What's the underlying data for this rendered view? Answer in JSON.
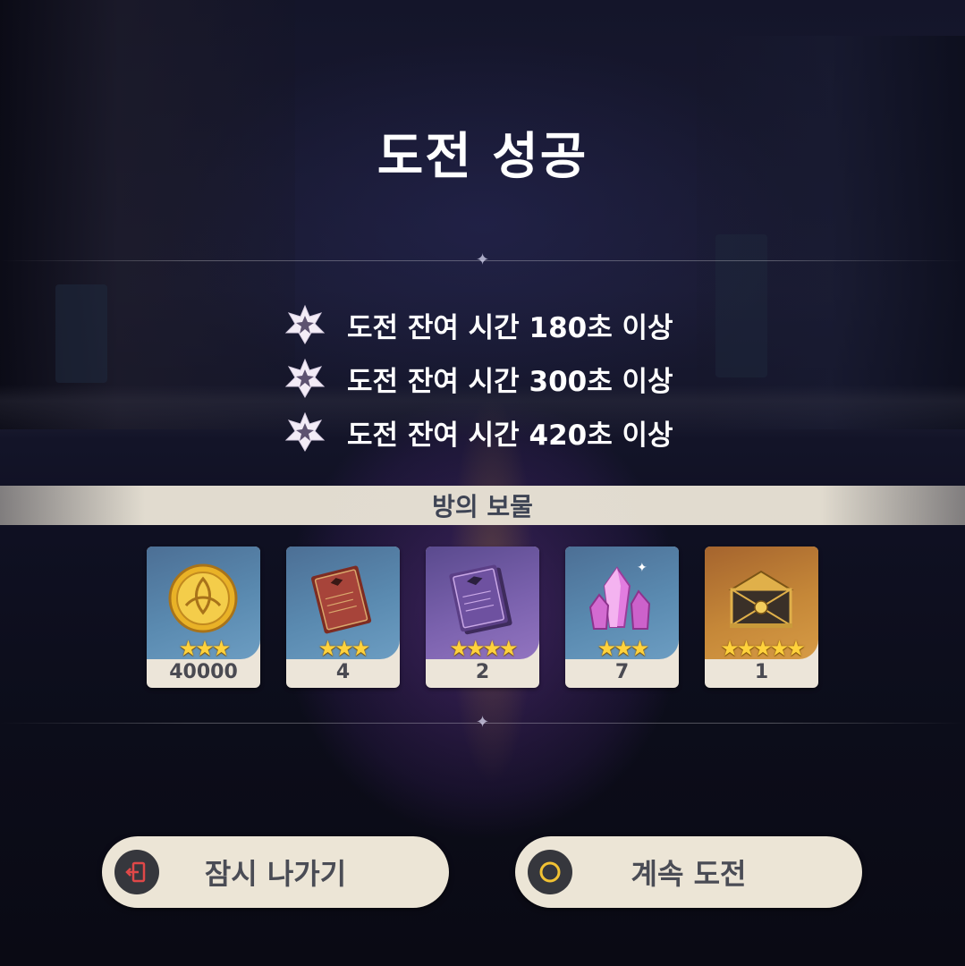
{
  "title": "도전 성공",
  "conditions": [
    {
      "text": "도전 잔여 시간 180초 이상",
      "icon": "challenge-star-icon"
    },
    {
      "text": "도전 잔여 시간 300초 이상",
      "icon": "challenge-star-icon"
    },
    {
      "text": "도전 잔여 시간 420초 이상",
      "icon": "challenge-star-icon"
    }
  ],
  "treasure": {
    "label": "방의 보물",
    "items": [
      {
        "icon": "mora-coin-icon",
        "stars": "★★★",
        "count": "40000",
        "rarity": 3
      },
      {
        "icon": "red-book-icon",
        "stars": "★★★",
        "count": "4",
        "rarity": 3
      },
      {
        "icon": "purple-book-icon",
        "stars": "★★★★",
        "count": "2",
        "rarity": 4
      },
      {
        "icon": "crystal-ore-icon",
        "stars": "★★★",
        "count": "7",
        "rarity": 3
      },
      {
        "icon": "golden-chest-icon",
        "stars": "★★★★★",
        "count": "1",
        "rarity": 5
      }
    ]
  },
  "buttons": {
    "exit_label": "잠시 나가기",
    "continue_label": "계속 도전"
  },
  "colors": {
    "exit_icon_accent": "#e04848",
    "continue_icon_accent": "#f2c233",
    "star_gold": "#ffd23c"
  }
}
